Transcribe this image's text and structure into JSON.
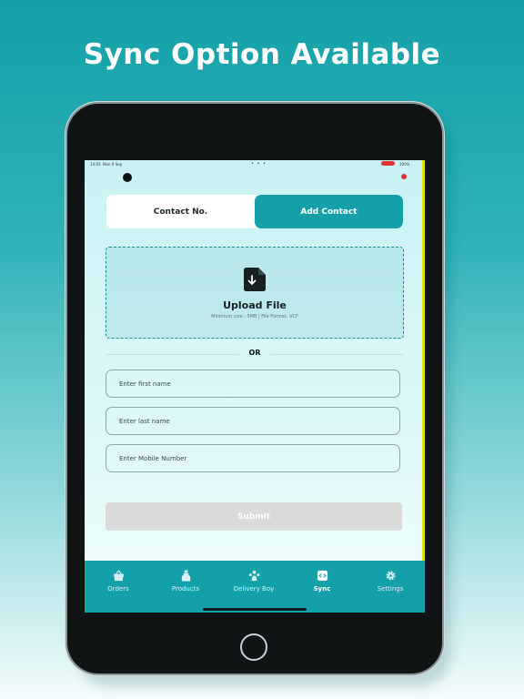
{
  "headline": "Sync Option Available",
  "status_bar": {
    "time": "14:03",
    "date": "Mon 9 Sep",
    "dots": "• • •",
    "battery": "100%"
  },
  "segmented": {
    "left_label": "Contact No.",
    "right_label": "Add Contact",
    "selected": "Add Contact"
  },
  "upload": {
    "title": "Upload File",
    "subtitle": "Minimum size : 5MB | File Format: VCF"
  },
  "divider_text": "OR",
  "form": {
    "first_name_placeholder": "Enter first name",
    "last_name_placeholder": "Enter last name",
    "mobile_placeholder": "Enter Mobile Number",
    "submit_label": "Submit"
  },
  "tabs": [
    {
      "label": "Orders",
      "icon": "basket-icon"
    },
    {
      "label": "Products",
      "icon": "bottle-icon"
    },
    {
      "label": "Delivery Boy",
      "icon": "people-icon"
    },
    {
      "label": "Sync",
      "icon": "sync-icon",
      "active": true
    },
    {
      "label": "Settings",
      "icon": "gear-icon"
    }
  ],
  "colors": {
    "accent": "#14a0a8",
    "background_top": "#14a0a8",
    "submit_disabled": "#dadada"
  }
}
